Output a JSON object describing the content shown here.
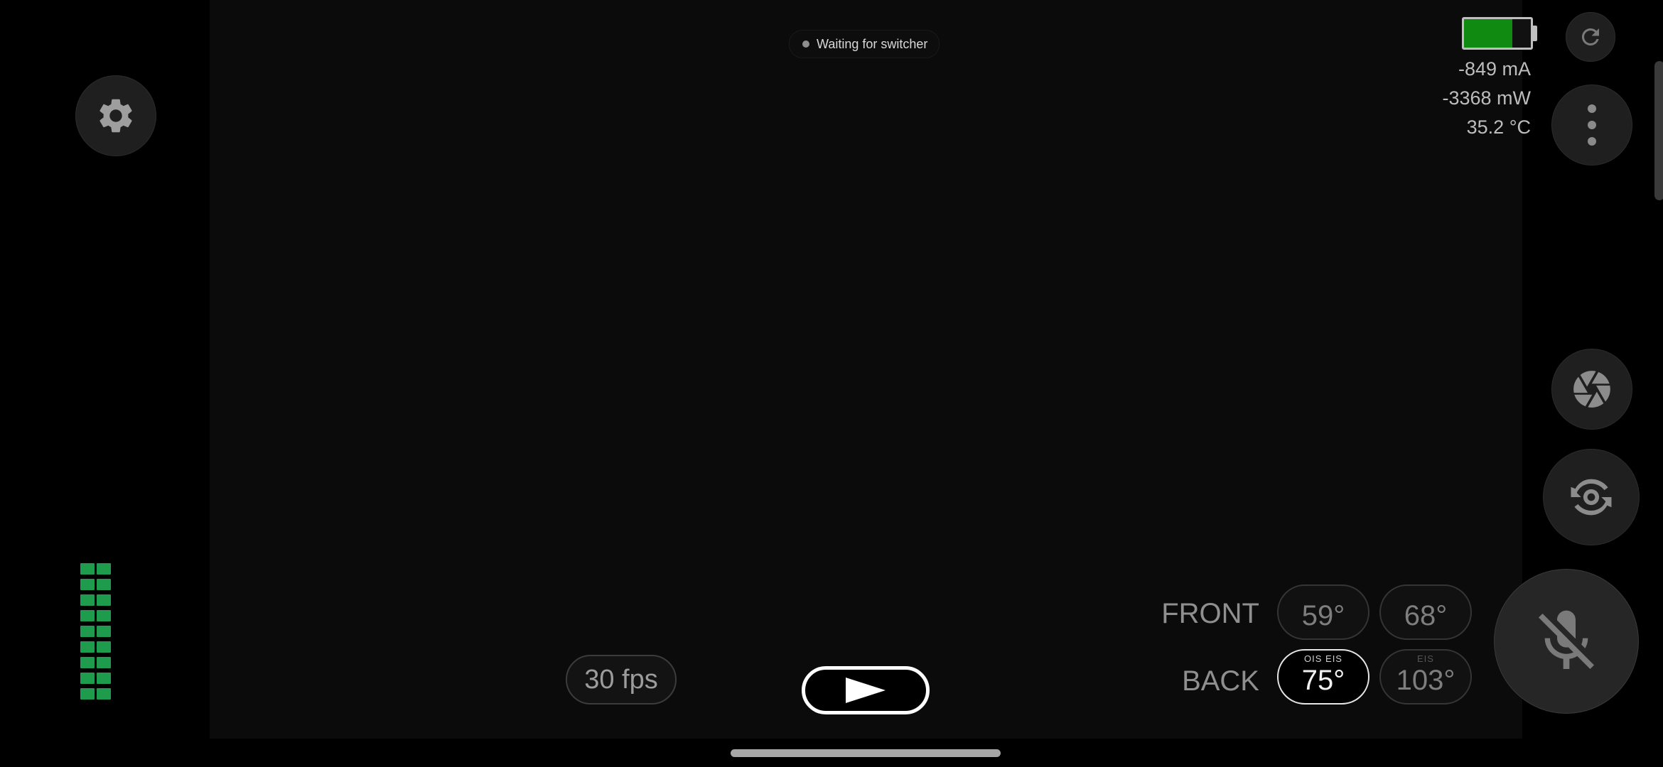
{
  "status": {
    "label": "Waiting for switcher"
  },
  "battery": {
    "level": 0.72,
    "fill_color": "#118a11"
  },
  "stats": {
    "current": "-849 mA",
    "power": "-3368 mW",
    "temperature": "35.2 °C"
  },
  "icons": {
    "settings": "gear-icon",
    "refresh": "refresh-icon",
    "more": "more-vertical-icon",
    "shutter": "aperture-icon",
    "switch_camera": "switch-camera-icon",
    "mic": "mic-off-icon",
    "record": "play-icon"
  },
  "audio_meter": {
    "segments": 9,
    "color": "#1e9b4c"
  },
  "fps": {
    "label": "30 fps"
  },
  "lenses": {
    "front": {
      "label": "FRONT",
      "options": [
        {
          "value": "59°",
          "tags": "",
          "selected": false
        },
        {
          "value": "68°",
          "tags": "",
          "selected": false
        }
      ]
    },
    "back": {
      "label": "BACK",
      "options": [
        {
          "value": "75°",
          "tags": "OIS  EIS",
          "selected": true
        },
        {
          "value": "103°",
          "tags": "EIS",
          "selected": false
        }
      ]
    }
  }
}
